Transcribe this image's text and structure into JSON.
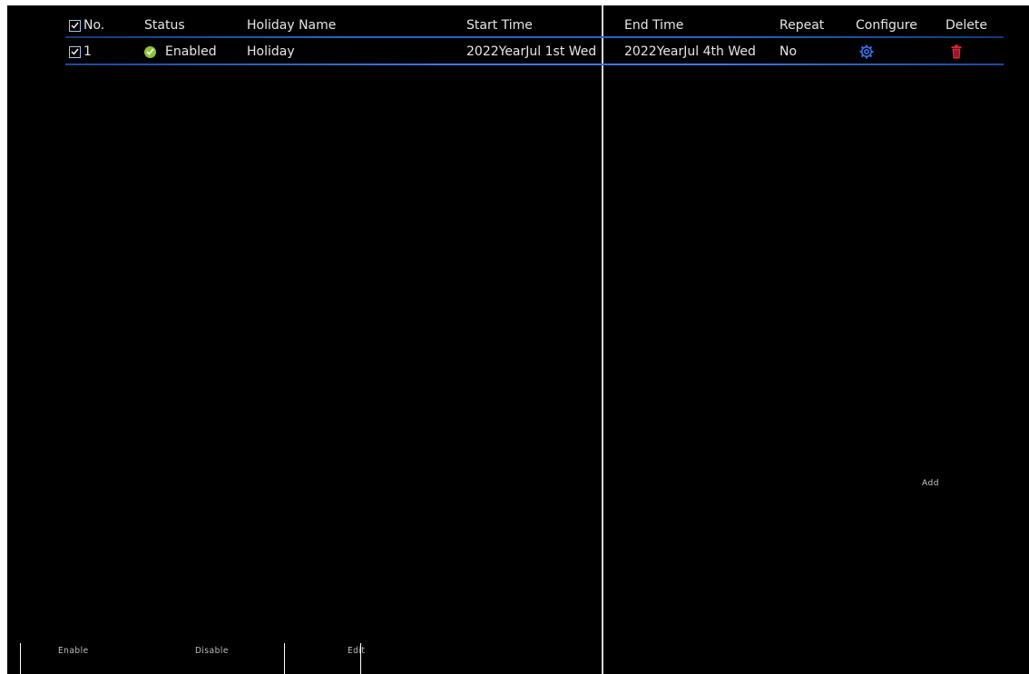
{
  "table": {
    "columns": [
      "No.",
      "Status",
      "Holiday Name",
      "Start Time",
      "End Time",
      "Repeat",
      "Configure",
      "Delete"
    ],
    "rows": [
      {
        "no": "1",
        "status": "Enabled",
        "holiday_name": "Holiday",
        "start_time": "2022YearJul 1st Wed",
        "end_time": "2022YearJul 4th Wed",
        "repeat": "No",
        "configure_icon": "gear-icon",
        "delete_icon": "trash-icon"
      }
    ]
  },
  "buttons": {
    "add": "Add",
    "enable": "Enable",
    "disable": "Disable",
    "edit": "Edit"
  },
  "colors": {
    "background": "#000000",
    "text": "#e6e6e6",
    "row_divider": "#2a64c8",
    "status_enabled": "#8fc23d",
    "configure_icon": "#3a6fe0",
    "delete_icon": "#e0283a",
    "checkbox_border": "#a9c3e6"
  }
}
